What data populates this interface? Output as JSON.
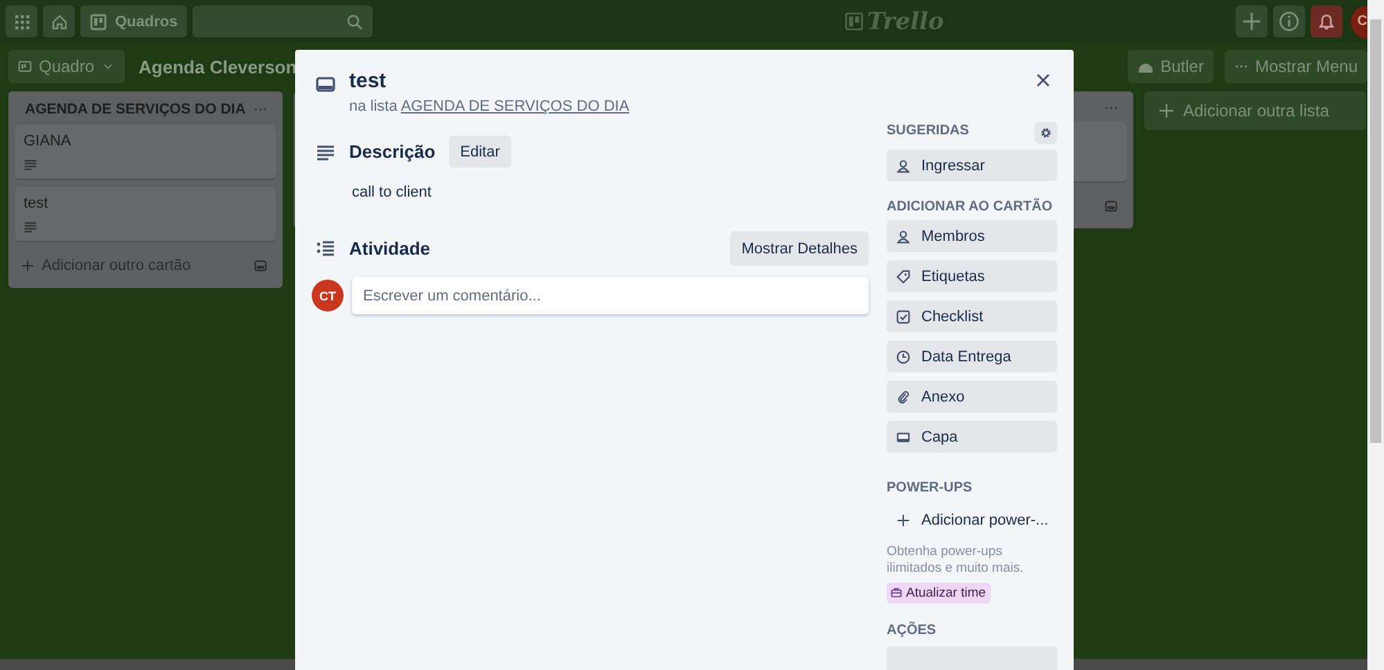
{
  "top_bar": {
    "boards_button": "Quadros",
    "logo": "Trello",
    "avatar": "C"
  },
  "board_header": {
    "view_button": "Quadro",
    "title": "Agenda Cleverson",
    "butler_button": "Butler",
    "menu_button": "Mostrar Menu"
  },
  "lists": [
    {
      "title": "AGENDA DE SERVIÇOS DO DIA",
      "cards": [
        {
          "title": "GIANA"
        },
        {
          "title": "test"
        }
      ],
      "add_card": "Adicionar outro cartão"
    }
  ],
  "add_list": "Adicionar outra lista",
  "card_modal": {
    "title": "test",
    "list_prefix": "na lista",
    "list_link": "AGENDA DE SERVIÇOS DO DIA",
    "description": {
      "heading": "Descrição",
      "edit_button": "Editar",
      "text": "call to client"
    },
    "activity": {
      "heading": "Atividade",
      "details_button": "Mostrar Detalhes",
      "avatar": "CT",
      "comment_placeholder": "Escrever um comentário..."
    },
    "sidebar": {
      "suggested_heading": "SUGERIDAS",
      "suggested": [
        "Ingressar"
      ],
      "add_heading": "ADICIONAR AO CARTÃO",
      "add_items": [
        "Membros",
        "Etiquetas",
        "Checklist",
        "Data Entrega",
        "Anexo",
        "Capa"
      ],
      "powerups_heading": "POWER-UPS",
      "add_powerup": "Adicionar power-...",
      "powerups_note": "Obtenha power-ups ilimitados e muito mais.",
      "upgrade_button": "Atualizar time",
      "actions_heading": "AÇÕES"
    }
  }
}
